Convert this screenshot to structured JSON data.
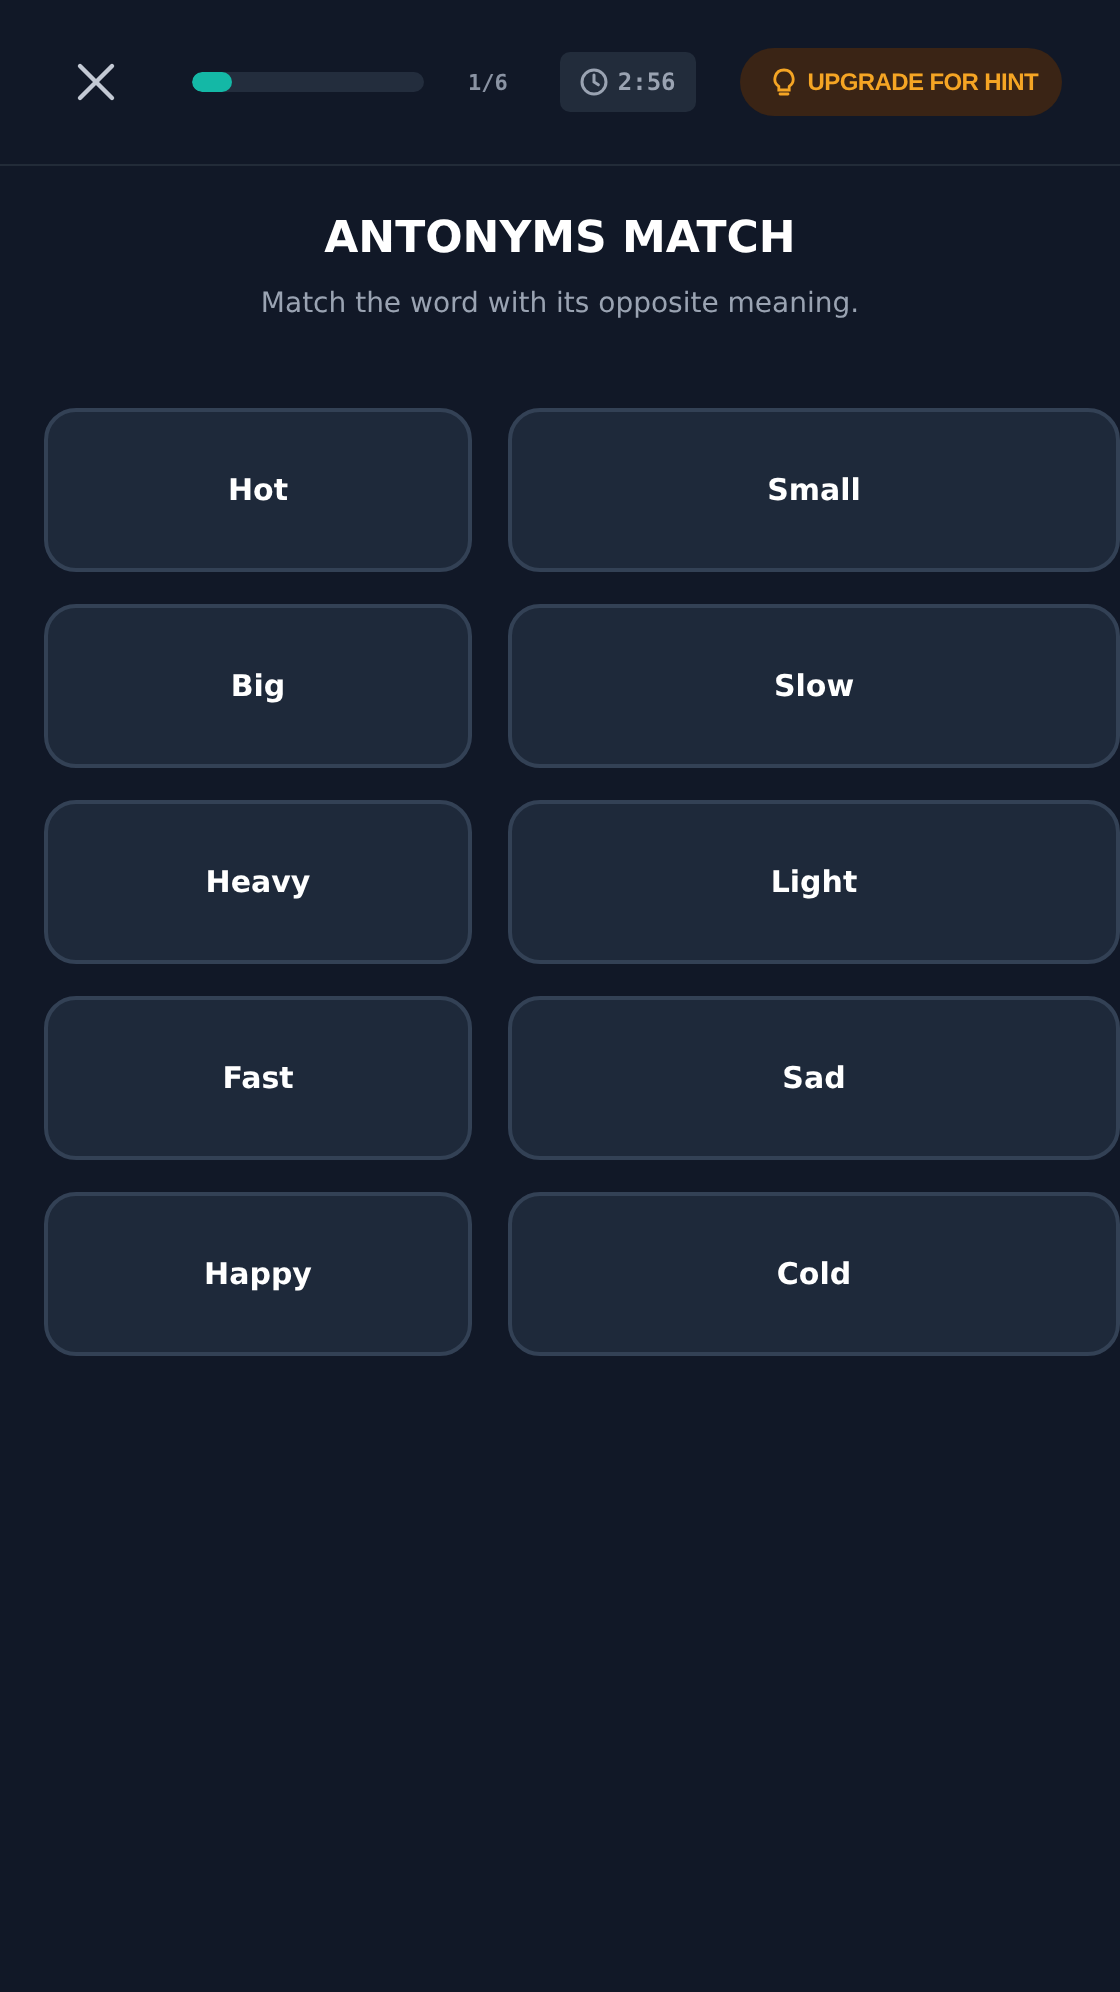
{
  "header": {
    "progress": {
      "level": 0.17
    },
    "counter": "1/6",
    "timer": "2:56",
    "hint_button": "UPGRADE FOR HINT"
  },
  "title": "ANTONYMS MATCH",
  "subtitle": "Match the word with its opposite meaning.",
  "left_words": [
    {
      "label": "Hot",
      "selected": false
    },
    {
      "label": "Big",
      "selected": false
    },
    {
      "label": "Heavy",
      "selected": false
    },
    {
      "label": "Fast",
      "selected": false
    },
    {
      "label": "Happy",
      "selected": false
    }
  ],
  "right_words": [
    {
      "label": "Small",
      "selected": false
    },
    {
      "label": "Slow",
      "selected": false
    },
    {
      "label": "Light",
      "selected": false
    },
    {
      "label": "Sad",
      "selected": false
    },
    {
      "label": "Cold",
      "selected": false
    }
  ]
}
